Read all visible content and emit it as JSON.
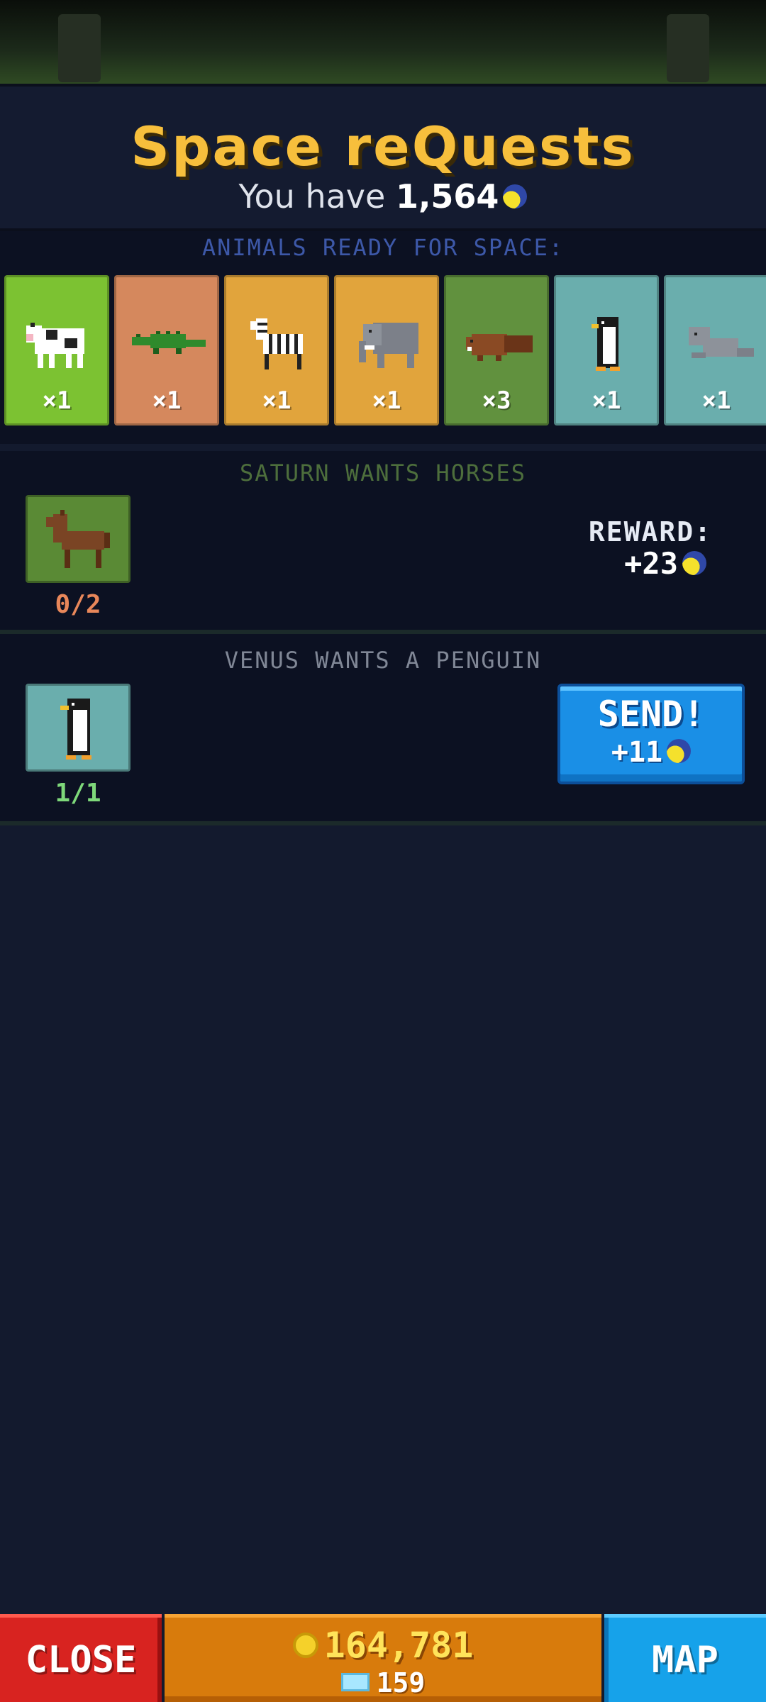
{
  "header": {
    "title": "Space reQuests",
    "have_prefix": "You have",
    "have_amount": "1,564"
  },
  "ready": {
    "label": "ANIMALS READY FOR SPACE:",
    "cards": [
      {
        "animal": "cow-icon",
        "count": "×1",
        "color": "#7cc232"
      },
      {
        "animal": "crocodile-icon",
        "count": "×1",
        "color": "#d5885d"
      },
      {
        "animal": "zebra-icon",
        "count": "×1",
        "color": "#e1a43c"
      },
      {
        "animal": "elephant-icon",
        "count": "×1",
        "color": "#e1a43c"
      },
      {
        "animal": "beaver-icon",
        "count": "×3",
        "color": "#61913e"
      },
      {
        "animal": "penguin-icon",
        "count": "×1",
        "color": "#6aaead"
      },
      {
        "animal": "seal-icon",
        "count": "×1",
        "color": "#6aaead"
      }
    ]
  },
  "requests": [
    {
      "title": "SATURN WANTS HORSES",
      "animal": "horse-icon",
      "progress": "0/2",
      "reward_label": "REWARD:",
      "reward_value": "+23"
    },
    {
      "title": "VENUS WANTS A PENGUIN",
      "animal": "penguin-icon",
      "progress": "1/1",
      "send_label": "SEND!",
      "send_value": "+11"
    }
  ],
  "bottom": {
    "close": "CLOSE",
    "coins": "164,781",
    "gems": "159",
    "map": "MAP"
  }
}
